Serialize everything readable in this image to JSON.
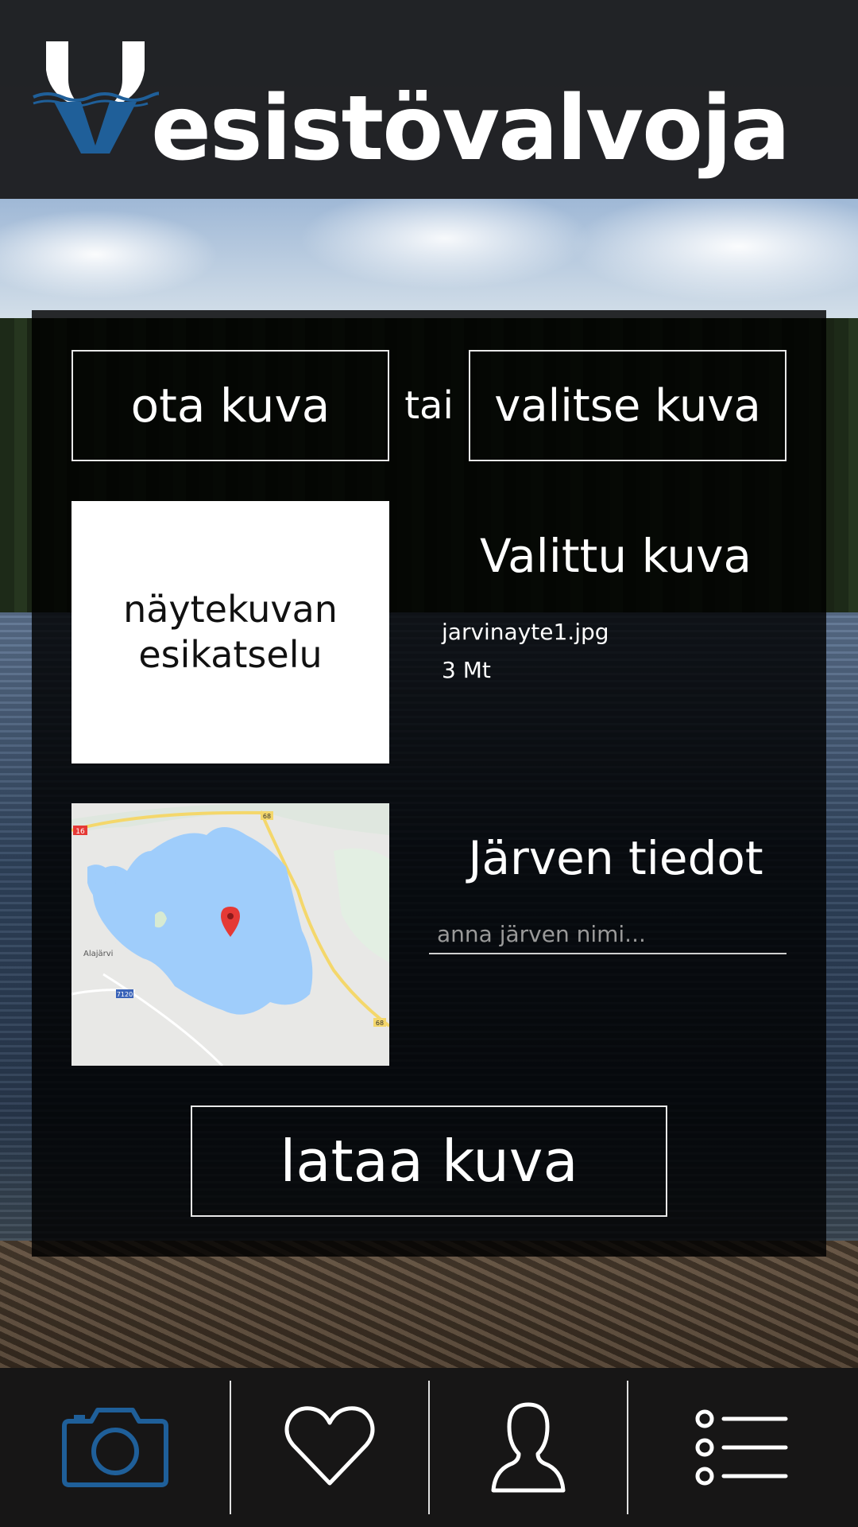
{
  "header": {
    "app_title": "esistövalvoja",
    "logo_letter": "V"
  },
  "capture": {
    "take_photo_label": "ota kuva",
    "or_label": "tai",
    "choose_photo_label": "valitse kuva"
  },
  "preview": {
    "placeholder_line1": "näytekuvan",
    "placeholder_line2": "esikatselu"
  },
  "selected": {
    "title": "Valittu kuva",
    "file_name": "jarvinayte1.jpg",
    "file_size": "3 Mt"
  },
  "map": {
    "labels": [
      "16",
      "68",
      "68",
      "7120",
      "Alajärvi"
    ]
  },
  "lake": {
    "title": "Järven tiedot",
    "name_placeholder": "anna järven nimi..."
  },
  "upload": {
    "label": "lataa kuva"
  },
  "nav": {
    "items": [
      {
        "icon": "camera-icon",
        "active": true
      },
      {
        "icon": "heart-icon",
        "active": false
      },
      {
        "icon": "profile-icon",
        "active": false
      },
      {
        "icon": "list-menu-icon",
        "active": false
      }
    ]
  },
  "colors": {
    "brand_blue": "#1f5f99",
    "active_nav": "#1f5f99",
    "panel_bg": "#000000",
    "text": "#ffffff"
  }
}
